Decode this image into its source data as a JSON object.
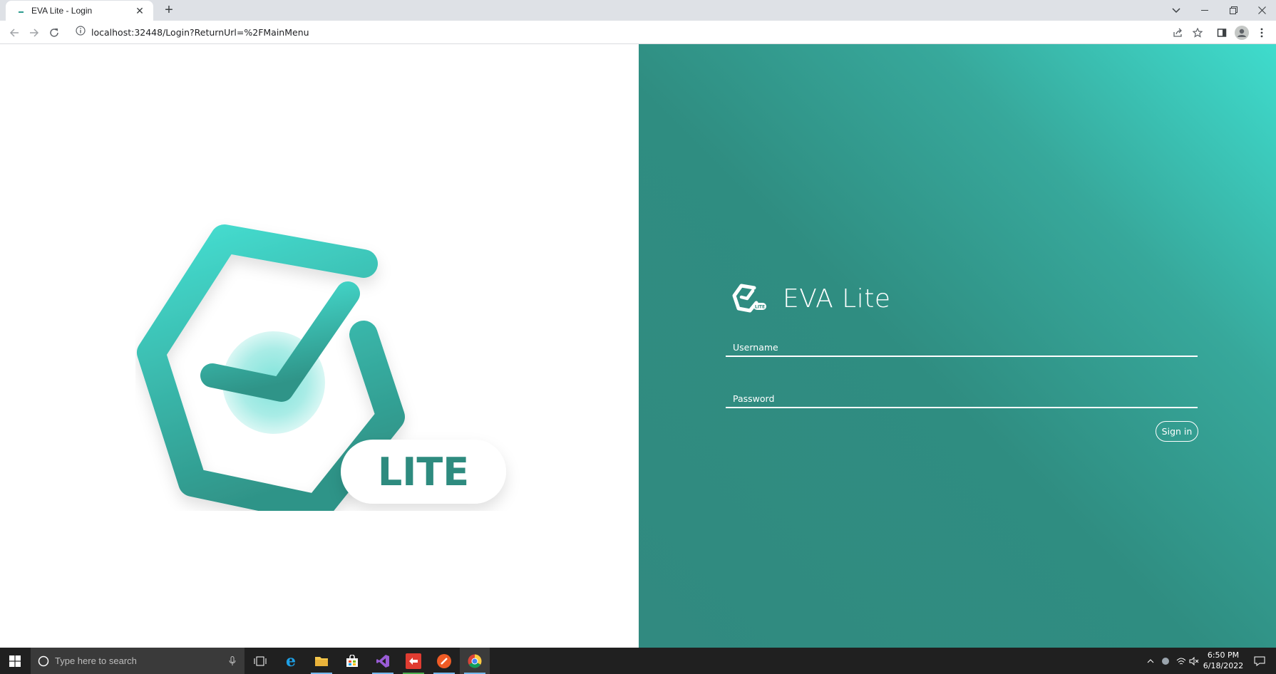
{
  "browser": {
    "tab_title": "EVA Lite - Login",
    "url": "localhost:32448/Login?ReturnUrl=%2FMainMenu"
  },
  "hero": {
    "badge_text": "LITE"
  },
  "login": {
    "app_name": "EVA Lite",
    "logo_badge": "LITE",
    "username_placeholder": "Username",
    "password_placeholder": "Password",
    "signin_label": "Sign in"
  },
  "taskbar": {
    "search_placeholder": "Type here to search",
    "time": "6:50 PM",
    "date": "6/18/2022"
  },
  "colors": {
    "brand_teal": "#3cc9bd",
    "brand_dark": "#2e8b7f",
    "gradient_light": "#3fdccd",
    "gradient_dark": "#2f8d81"
  }
}
